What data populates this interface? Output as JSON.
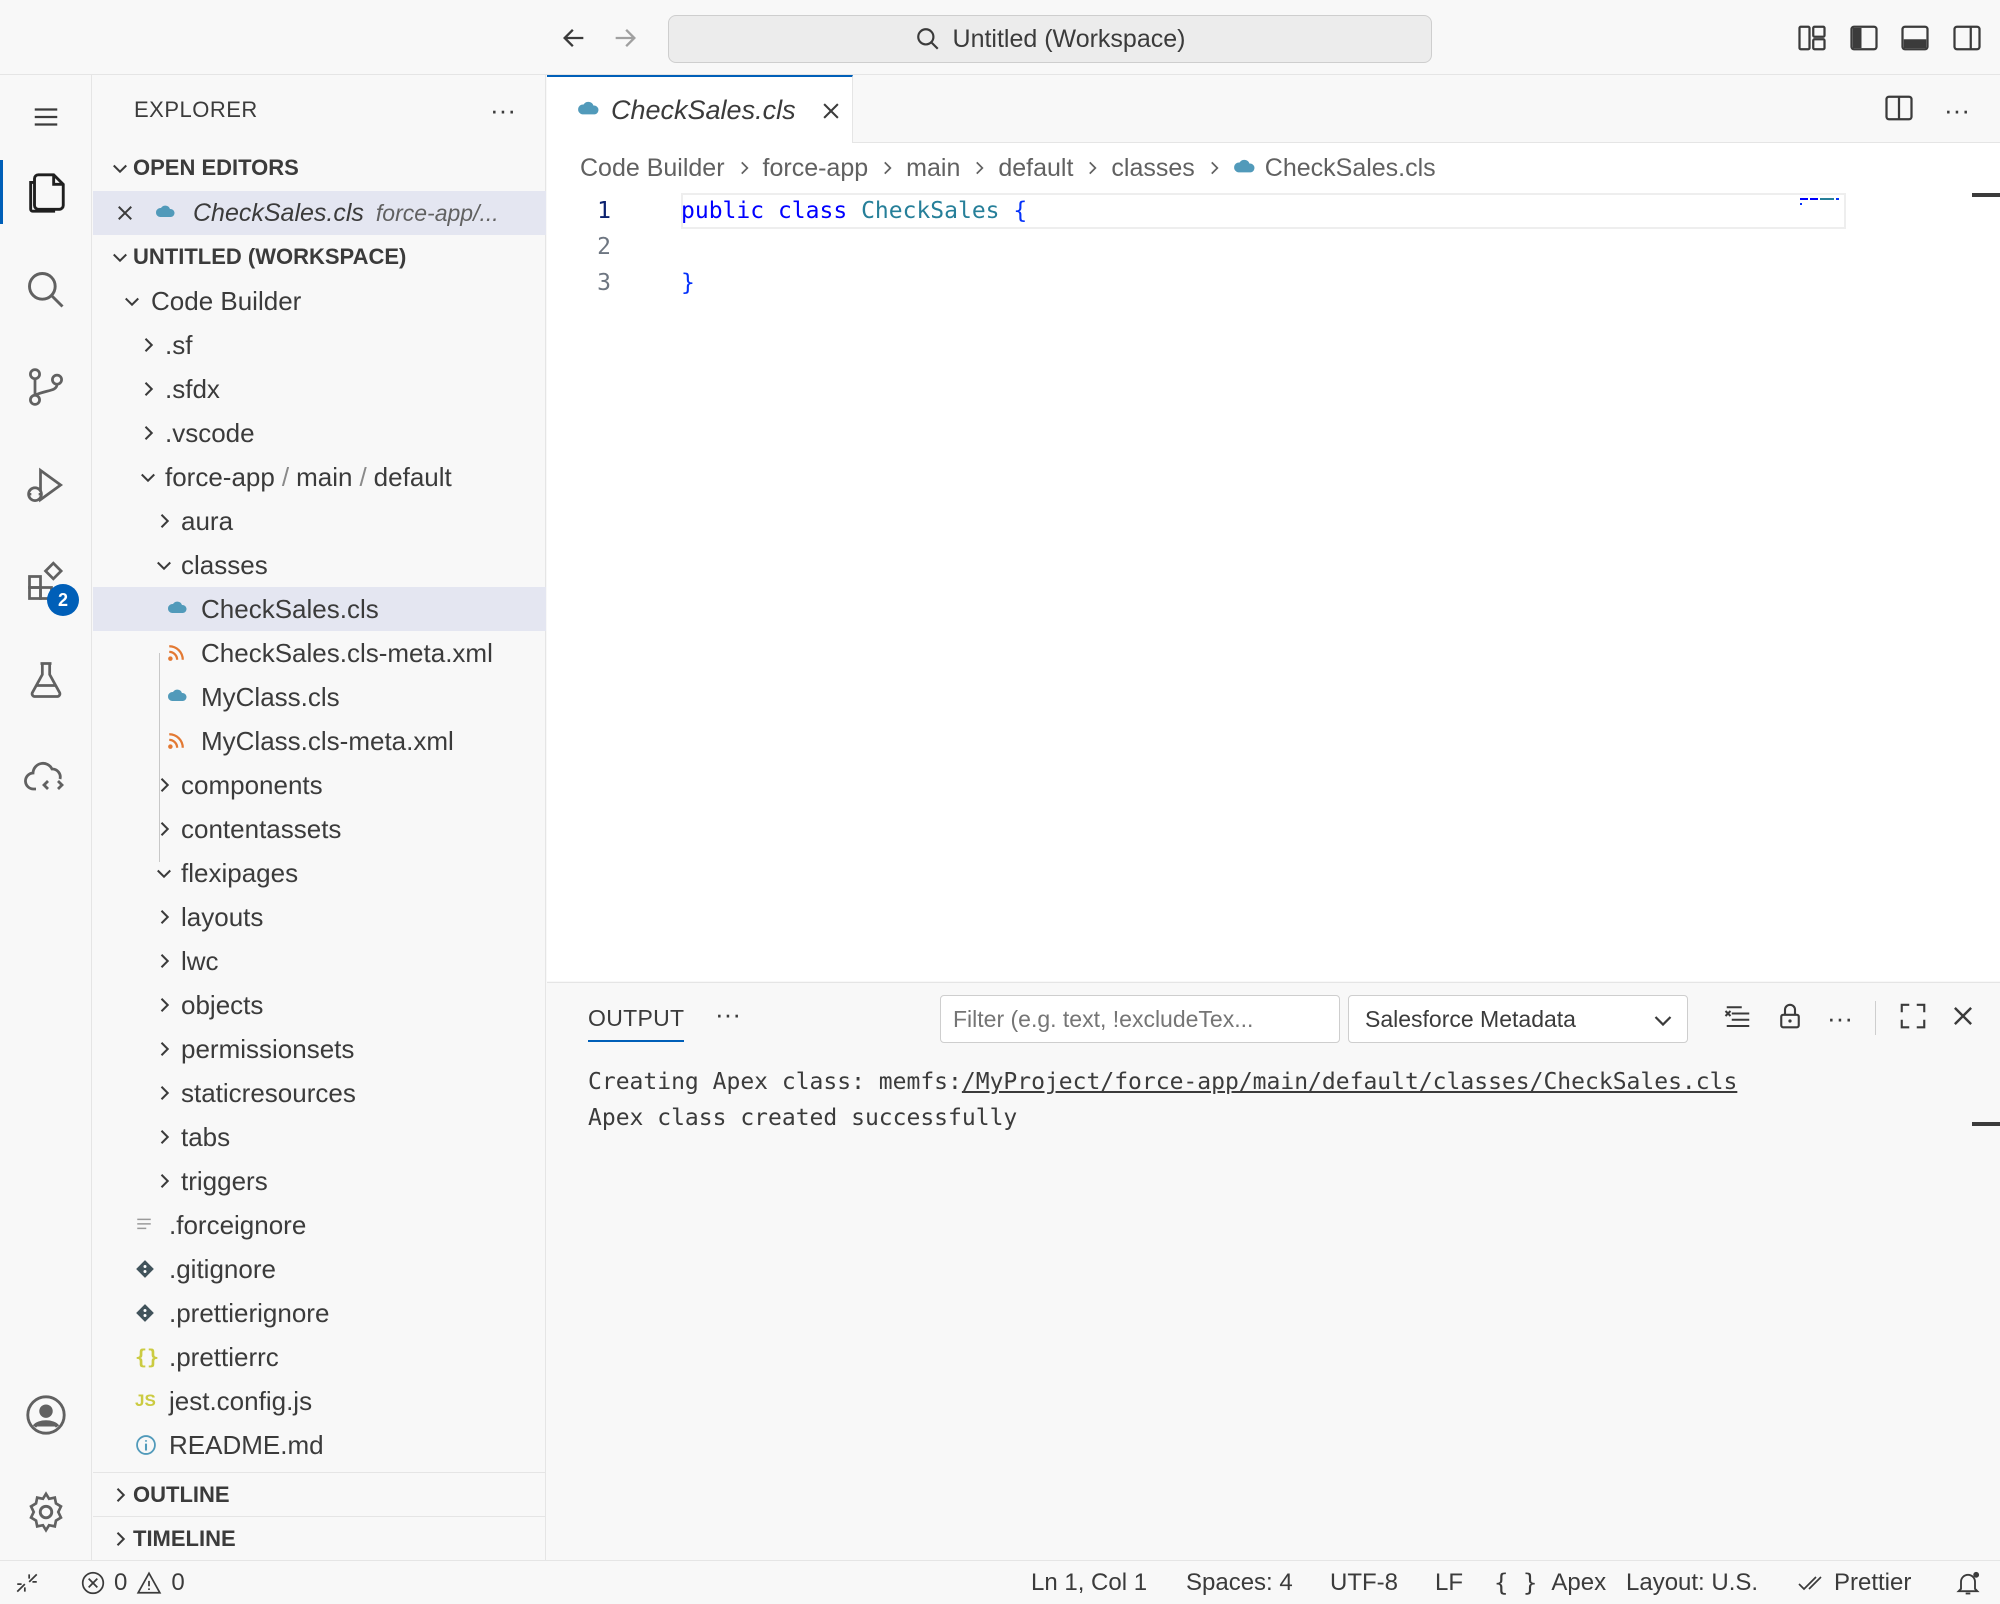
{
  "window": {
    "command_center": "Untitled (Workspace)"
  },
  "activity_bar": {
    "extensions_badge": "2"
  },
  "sidebar": {
    "title": "EXPLORER",
    "open_editors_label": "OPEN EDITORS",
    "open_editor": {
      "name": "CheckSales.cls",
      "path": "force-app/..."
    },
    "workspace_label": "UNTITLED (WORKSPACE)",
    "tree": {
      "root": "Code Builder",
      "sf": ".sf",
      "sfdx": ".sfdx",
      "vscode": ".vscode",
      "force_app": {
        "part1": "force-app",
        "part2": "main",
        "part3": "default",
        "sep": "/"
      },
      "aura": "aura",
      "classes": "classes",
      "file_checksales": "CheckSales.cls",
      "file_checksales_meta": "CheckSales.cls-meta.xml",
      "file_myclass": "MyClass.cls",
      "file_myclass_meta": "MyClass.cls-meta.xml",
      "components": "components",
      "contentassets": "contentassets",
      "flexipages": "flexipages",
      "layouts": "layouts",
      "lwc": "lwc",
      "objects": "objects",
      "permissionsets": "permissionsets",
      "staticresources": "staticresources",
      "tabs": "tabs",
      "triggers": "triggers",
      "forceignore": ".forceignore",
      "gitignore": ".gitignore",
      "prettierignore": ".prettierignore",
      "prettierrc": ".prettierrc",
      "jest": "jest.config.js",
      "readme": "README.md"
    },
    "outline_label": "OUTLINE",
    "timeline_label": "TIMELINE"
  },
  "editor": {
    "tab_label": "CheckSales.cls",
    "breadcrumb": [
      "Code Builder",
      "force-app",
      "main",
      "default",
      "classes",
      "CheckSales.cls"
    ],
    "line_numbers": [
      "1",
      "2",
      "3"
    ],
    "code": {
      "kw_public": "public",
      "kw_class": "class",
      "class_name": "CheckSales",
      "open_brace": "{",
      "close_brace": "}"
    }
  },
  "panel": {
    "tab_label": "OUTPUT",
    "filter_placeholder": "Filter (e.g. text, !excludeTex...",
    "channel": "Salesforce Metadata",
    "output": {
      "line1_prefix": "Creating Apex class: memfs:",
      "line1_path": "/MyProject/force-app/main/default/classes/CheckSales.cls",
      "line2": "Apex class created successfully"
    }
  },
  "statusbar": {
    "errors": "0",
    "warnings": "0",
    "position": "Ln 1, Col 1",
    "spaces": "Spaces: 4",
    "encoding": "UTF-8",
    "eol": "LF",
    "language": "Apex",
    "layout": "Layout: U.S.",
    "formatter": "Prettier"
  },
  "colors": {
    "accent": "#005fb8",
    "selection": "#e4e6f1",
    "keyword": "#0000ff",
    "type": "#267f99",
    "apex_icon": "#519aba",
    "xml_icon": "#e37933",
    "json_icon": "#cbcb41"
  }
}
